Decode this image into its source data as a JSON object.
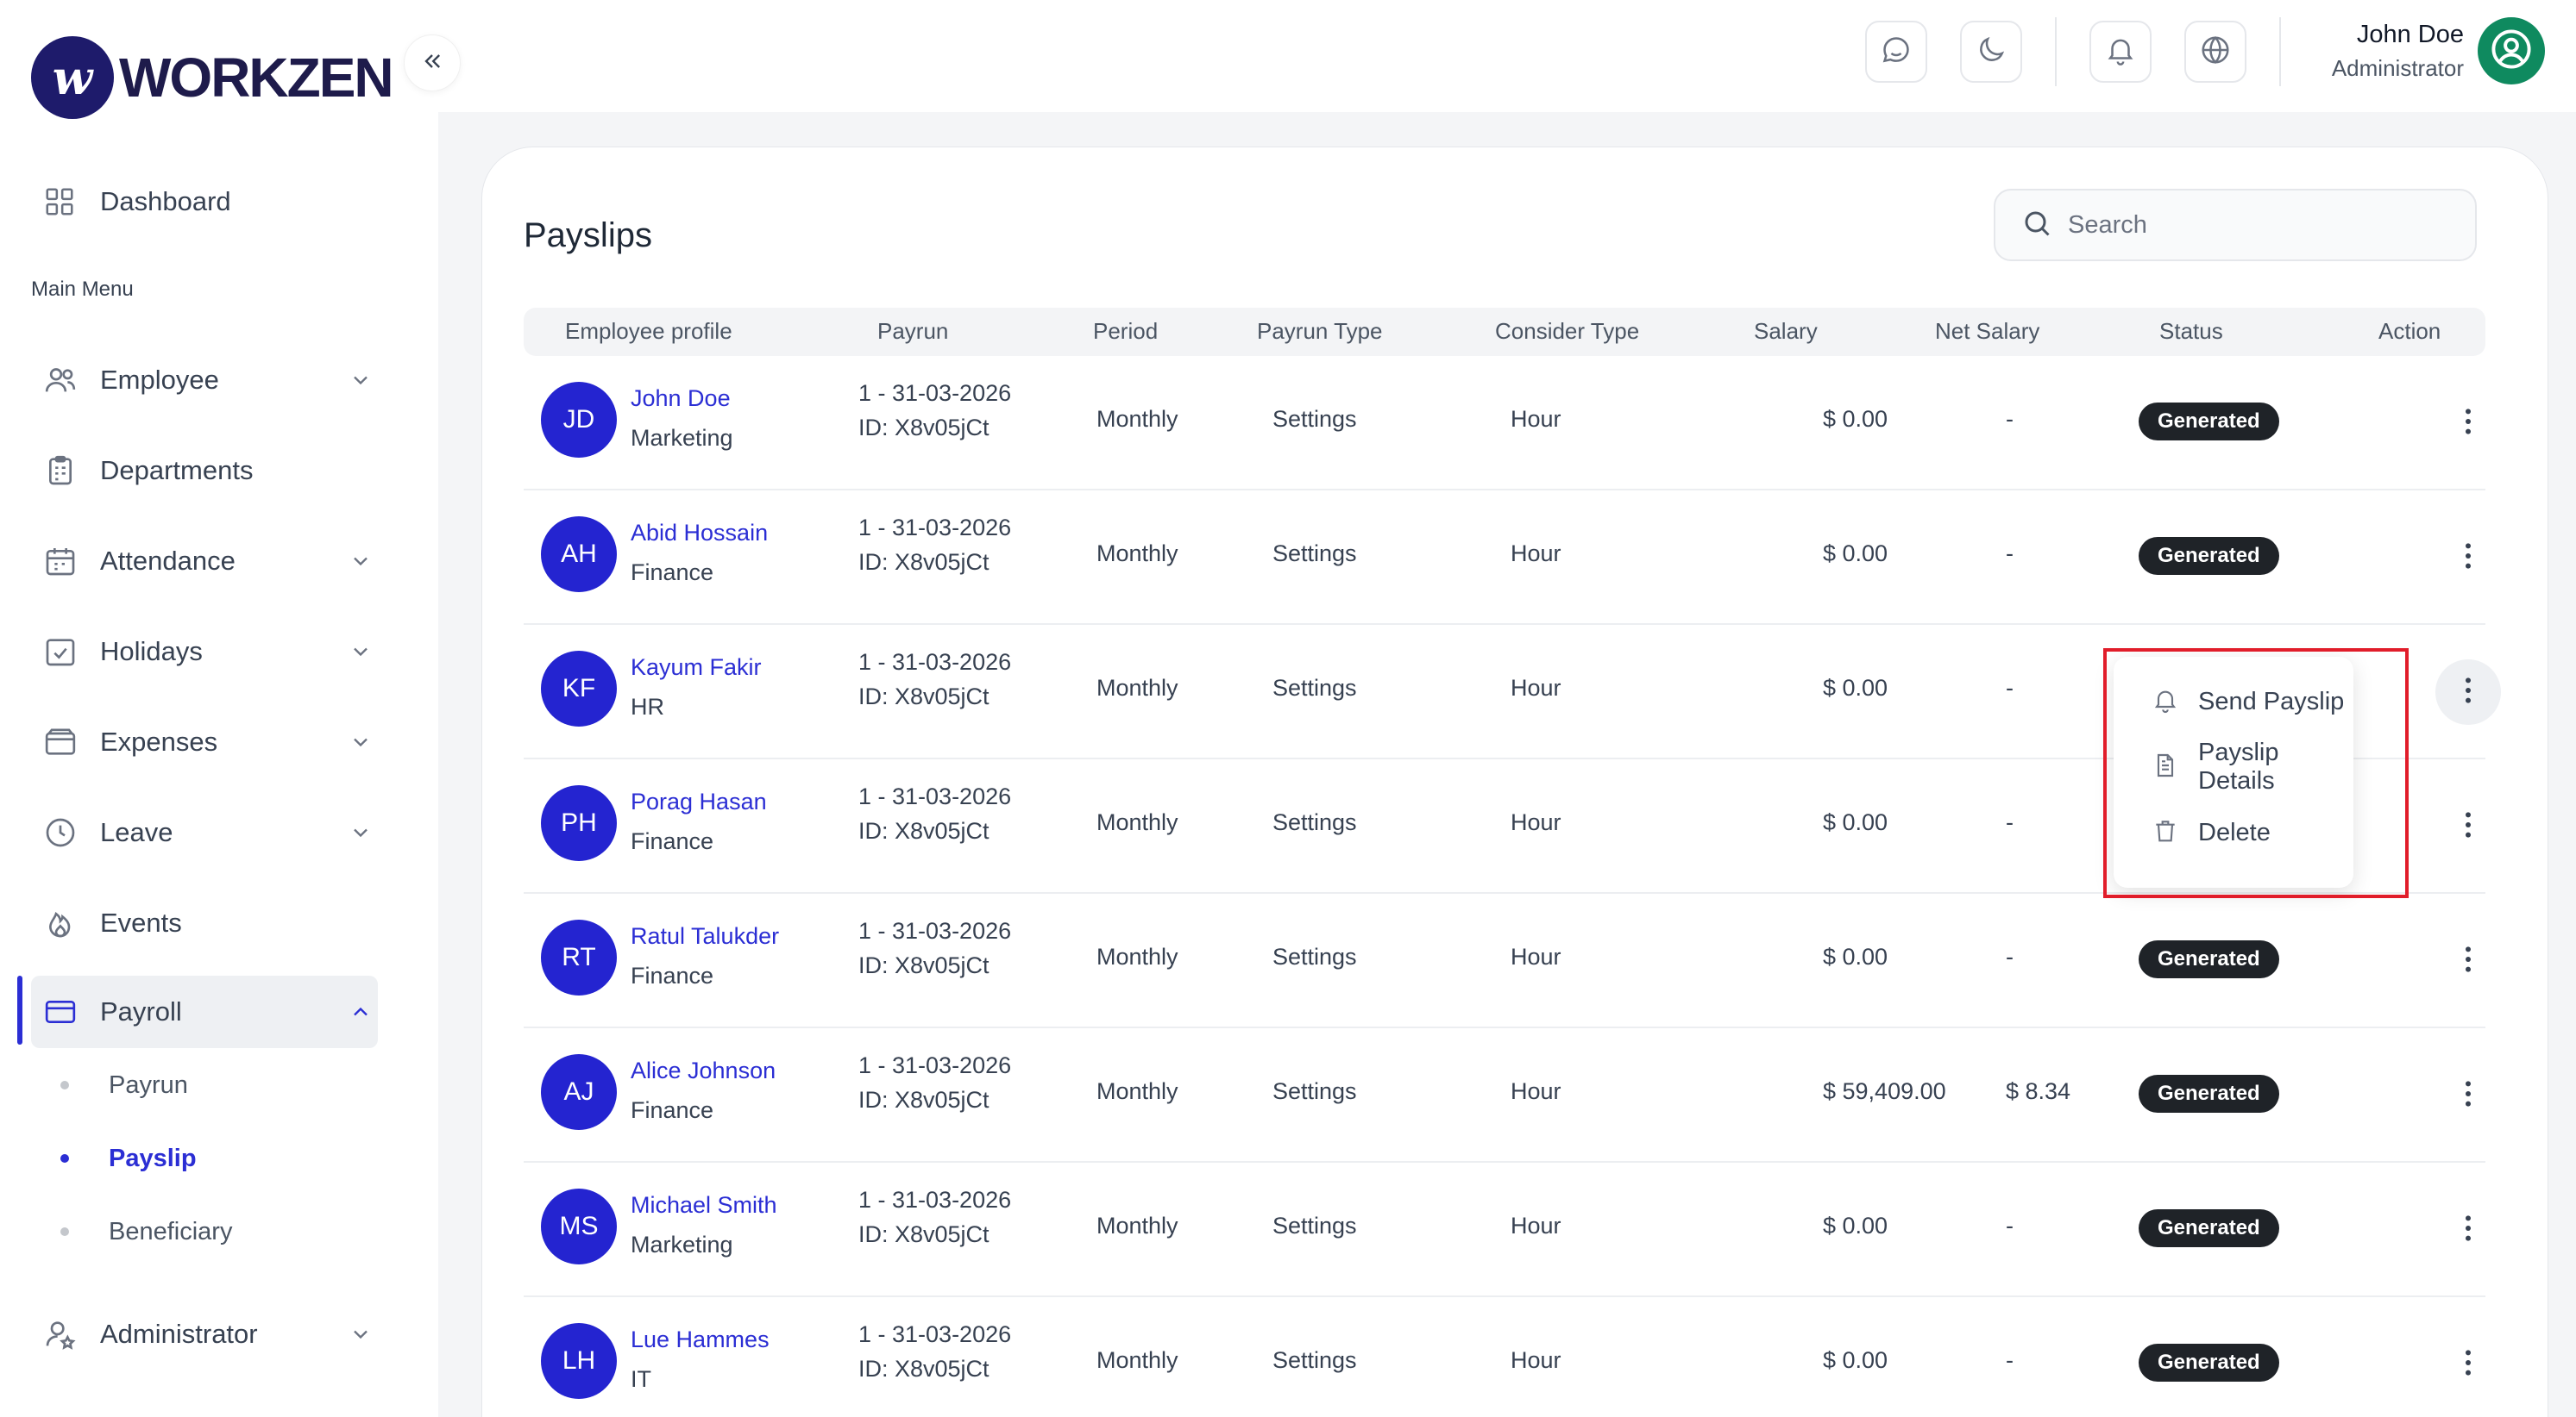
{
  "brand": {
    "name": "WORKZEN"
  },
  "sidebar": {
    "dashboard": "Dashboard",
    "section": "Main Menu",
    "items": [
      {
        "label": "Employee"
      },
      {
        "label": "Departments"
      },
      {
        "label": "Attendance"
      },
      {
        "label": "Holidays"
      },
      {
        "label": "Expenses"
      },
      {
        "label": "Leave"
      },
      {
        "label": "Events"
      },
      {
        "label": "Payroll"
      },
      {
        "label": "Administrator"
      }
    ],
    "payroll_sub": [
      {
        "label": "Payrun"
      },
      {
        "label": "Payslip"
      },
      {
        "label": "Beneficiary"
      }
    ]
  },
  "header": {
    "user_name": "John Doe",
    "user_role": "Administrator"
  },
  "page": {
    "title": "Payslips",
    "search_placeholder": "Search"
  },
  "table": {
    "columns": [
      "Employee profile",
      "Payrun",
      "Period",
      "Payrun Type",
      "Consider Type",
      "Salary",
      "Net Salary",
      "Status",
      "Action"
    ],
    "rows": [
      {
        "initials": "JD",
        "name": "John Doe",
        "dept": "Marketing",
        "payrun": "1 - 31-03-2026",
        "payrun_id": "ID: X8v05jCt",
        "period": "Monthly",
        "type": "Settings",
        "consider": "Hour",
        "salary": "$ 0.00",
        "net": "-",
        "status": "Generated"
      },
      {
        "initials": "AH",
        "name": "Abid Hossain",
        "dept": "Finance",
        "payrun": "1 - 31-03-2026",
        "payrun_id": "ID: X8v05jCt",
        "period": "Monthly",
        "type": "Settings",
        "consider": "Hour",
        "salary": "$ 0.00",
        "net": "-",
        "status": "Generated"
      },
      {
        "initials": "KF",
        "name": "Kayum Fakir",
        "dept": "HR",
        "payrun": "1 - 31-03-2026",
        "payrun_id": "ID: X8v05jCt",
        "period": "Monthly",
        "type": "Settings",
        "consider": "Hour",
        "salary": "$ 0.00",
        "net": "-",
        "status": ""
      },
      {
        "initials": "PH",
        "name": "Porag Hasan",
        "dept": "Finance",
        "payrun": "1 - 31-03-2026",
        "payrun_id": "ID: X8v05jCt",
        "period": "Monthly",
        "type": "Settings",
        "consider": "Hour",
        "salary": "$ 0.00",
        "net": "-",
        "status": ""
      },
      {
        "initials": "RT",
        "name": "Ratul Talukder",
        "dept": "Finance",
        "payrun": "1 - 31-03-2026",
        "payrun_id": "ID: X8v05jCt",
        "period": "Monthly",
        "type": "Settings",
        "consider": "Hour",
        "salary": "$ 0.00",
        "net": "-",
        "status": "Generated"
      },
      {
        "initials": "AJ",
        "name": "Alice Johnson",
        "dept": "Finance",
        "payrun": "1 - 31-03-2026",
        "payrun_id": "ID: X8v05jCt",
        "period": "Monthly",
        "type": "Settings",
        "consider": "Hour",
        "salary": "$ 59,409.00",
        "net": "$ 8.34",
        "status": "Generated"
      },
      {
        "initials": "MS",
        "name": "Michael Smith",
        "dept": "Marketing",
        "payrun": "1 - 31-03-2026",
        "payrun_id": "ID: X8v05jCt",
        "period": "Monthly",
        "type": "Settings",
        "consider": "Hour",
        "salary": "$ 0.00",
        "net": "-",
        "status": "Generated"
      },
      {
        "initials": "LH",
        "name": "Lue Hammes",
        "dept": "IT",
        "payrun": "1 - 31-03-2026",
        "payrun_id": "ID: X8v05jCt",
        "period": "Monthly",
        "type": "Settings",
        "consider": "Hour",
        "salary": "$ 0.00",
        "net": "-",
        "status": "Generated"
      }
    ]
  },
  "action_menu": {
    "items": [
      {
        "label": "Send Payslip",
        "icon": "bell-icon"
      },
      {
        "label": "Payslip Details",
        "icon": "document-icon"
      },
      {
        "label": "Delete",
        "icon": "trash-icon"
      }
    ]
  },
  "colors": {
    "accent": "#2b2ed4",
    "badge": "#1f2328",
    "highlight": "#e11d2a"
  }
}
